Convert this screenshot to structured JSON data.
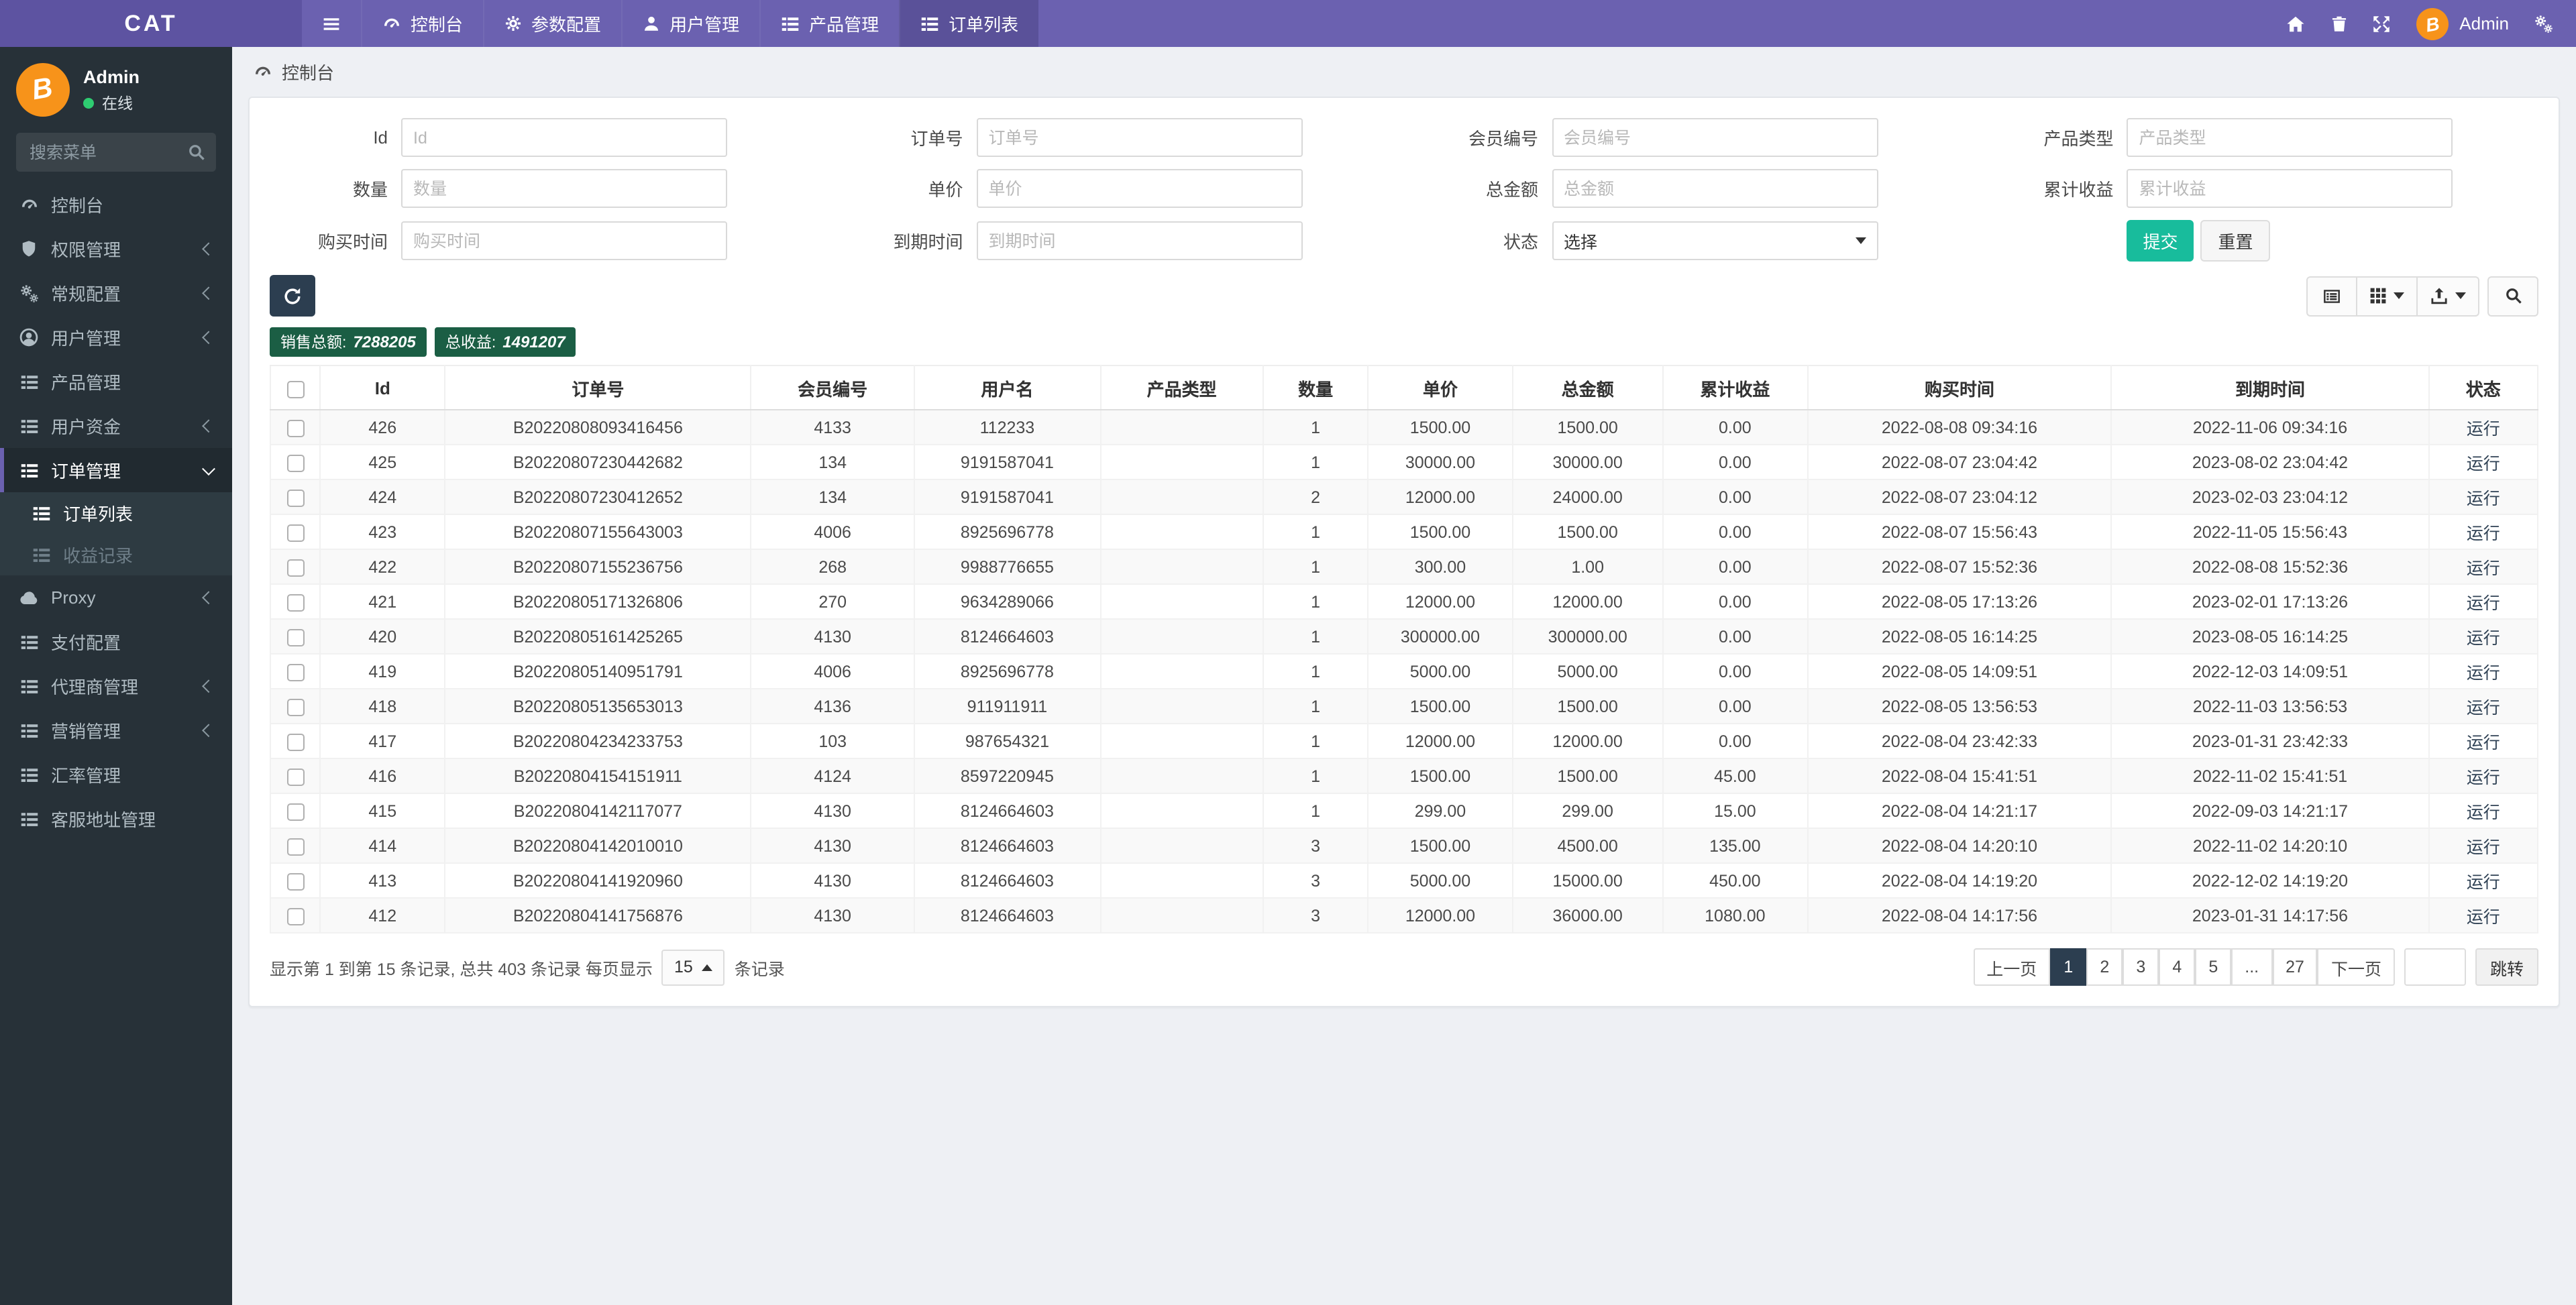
{
  "navbar": {
    "brand": "CAT",
    "items": [
      {
        "label": "控制台",
        "icon": "gauge",
        "name": "dashboard",
        "active": false
      },
      {
        "label": "参数配置",
        "icon": "gear",
        "name": "params-config",
        "active": false
      },
      {
        "label": "用户管理",
        "icon": "user",
        "name": "user-management",
        "active": false
      },
      {
        "label": "产品管理",
        "icon": "list",
        "name": "product-management",
        "active": false
      },
      {
        "label": "订单列表",
        "icon": "list",
        "name": "order-list",
        "active": true
      }
    ],
    "right": {
      "user": {
        "name": "Admin",
        "avatar_glyph": "B"
      }
    }
  },
  "sidebar": {
    "user": {
      "name": "Admin",
      "status": "在线",
      "avatar_glyph": "B"
    },
    "search": {
      "placeholder": "搜索菜单"
    },
    "menu": [
      {
        "label": "控制台",
        "icon": "gauge",
        "name": "dashboard"
      },
      {
        "label": "权限管理",
        "icon": "shield",
        "name": "permission-management",
        "chevron": "left"
      },
      {
        "label": "常规配置",
        "icon": "cogs",
        "name": "general-config",
        "chevron": "left"
      },
      {
        "label": "用户管理",
        "icon": "user-circle",
        "name": "user-management",
        "chevron": "left"
      },
      {
        "label": "产品管理",
        "icon": "list",
        "name": "product-management"
      },
      {
        "label": "用户资金",
        "icon": "list",
        "name": "user-funds",
        "chevron": "left"
      },
      {
        "label": "订单管理",
        "icon": "list",
        "name": "order-management",
        "chevron": "down",
        "active": true,
        "children": [
          {
            "label": "订单列表",
            "icon": "list",
            "name": "order-list",
            "active": true
          },
          {
            "label": "收益记录",
            "icon": "list",
            "name": "profit-records",
            "muted": true
          }
        ]
      },
      {
        "label": "Proxy",
        "icon": "cloud",
        "name": "proxy",
        "chevron": "left"
      },
      {
        "label": "支付配置",
        "icon": "list",
        "name": "payment-config"
      },
      {
        "label": "代理商管理",
        "icon": "list",
        "name": "agent-management",
        "chevron": "left"
      },
      {
        "label": "营销管理",
        "icon": "list",
        "name": "marketing-management",
        "chevron": "left"
      },
      {
        "label": "汇率管理",
        "icon": "list",
        "name": "exchange-rate-management"
      },
      {
        "label": "客服地址管理",
        "icon": "list",
        "name": "service-address-management"
      }
    ]
  },
  "breadcrumb": {
    "label": "控制台"
  },
  "filter_form": {
    "rows": [
      [
        {
          "label": "Id",
          "placeholder": "Id",
          "name": "id",
          "type": "text"
        },
        {
          "label": "订单号",
          "placeholder": "订单号",
          "name": "order-no",
          "type": "text"
        },
        {
          "label": "会员编号",
          "placeholder": "会员编号",
          "name": "member-no",
          "type": "text"
        },
        {
          "label": "产品类型",
          "placeholder": "产品类型",
          "name": "product-type",
          "type": "text"
        }
      ],
      [
        {
          "label": "数量",
          "placeholder": "数量",
          "name": "quantity",
          "type": "text"
        },
        {
          "label": "单价",
          "placeholder": "单价",
          "name": "unit-price",
          "type": "text"
        },
        {
          "label": "总金额",
          "placeholder": "总金额",
          "name": "total-amount",
          "type": "text"
        },
        {
          "label": "累计收益",
          "placeholder": "累计收益",
          "name": "accumulated-profit",
          "type": "text"
        }
      ],
      [
        {
          "label": "购买时间",
          "placeholder": "购买时间",
          "name": "buy-time",
          "type": "text"
        },
        {
          "label": "到期时间",
          "placeholder": "到期时间",
          "name": "expire-time",
          "type": "text"
        },
        {
          "label": "状态",
          "value": "选择",
          "name": "status",
          "type": "select"
        },
        {
          "type": "buttons",
          "name": "form-actions"
        }
      ]
    ],
    "submit_label": "提交",
    "reset_label": "重置"
  },
  "stats": [
    {
      "name": "sales-total",
      "label": "销售总额:",
      "value": "7288205"
    },
    {
      "name": "profit-total",
      "label": "总收益:",
      "value": "1491207"
    }
  ],
  "table": {
    "columns": [
      "Id",
      "订单号",
      "会员编号",
      "用户名",
      "产品类型",
      "数量",
      "单价",
      "总金额",
      "累计收益",
      "购买时间",
      "到期时间",
      "状态"
    ],
    "rows": [
      [
        "426",
        "B20220808093416456",
        "4133",
        "112233",
        "",
        "1",
        "1500.00",
        "1500.00",
        "0.00",
        "2022-08-08 09:34:16",
        "2022-11-06 09:34:16",
        "运行"
      ],
      [
        "425",
        "B20220807230442682",
        "134",
        "9191587041",
        "",
        "1",
        "30000.00",
        "30000.00",
        "0.00",
        "2022-08-07 23:04:42",
        "2023-08-02 23:04:42",
        "运行"
      ],
      [
        "424",
        "B20220807230412652",
        "134",
        "9191587041",
        "",
        "2",
        "12000.00",
        "24000.00",
        "0.00",
        "2022-08-07 23:04:12",
        "2023-02-03 23:04:12",
        "运行"
      ],
      [
        "423",
        "B20220807155643003",
        "4006",
        "8925696778",
        "",
        "1",
        "1500.00",
        "1500.00",
        "0.00",
        "2022-08-07 15:56:43",
        "2022-11-05 15:56:43",
        "运行"
      ],
      [
        "422",
        "B20220807155236756",
        "268",
        "9988776655",
        "",
        "1",
        "300.00",
        "1.00",
        "0.00",
        "2022-08-07 15:52:36",
        "2022-08-08 15:52:36",
        "运行"
      ],
      [
        "421",
        "B20220805171326806",
        "270",
        "9634289066",
        "",
        "1",
        "12000.00",
        "12000.00",
        "0.00",
        "2022-08-05 17:13:26",
        "2023-02-01 17:13:26",
        "运行"
      ],
      [
        "420",
        "B20220805161425265",
        "4130",
        "8124664603",
        "",
        "1",
        "300000.00",
        "300000.00",
        "0.00",
        "2022-08-05 16:14:25",
        "2023-08-05 16:14:25",
        "运行"
      ],
      [
        "419",
        "B20220805140951791",
        "4006",
        "8925696778",
        "",
        "1",
        "5000.00",
        "5000.00",
        "0.00",
        "2022-08-05 14:09:51",
        "2022-12-03 14:09:51",
        "运行"
      ],
      [
        "418",
        "B20220805135653013",
        "4136",
        "911911911",
        "",
        "1",
        "1500.00",
        "1500.00",
        "0.00",
        "2022-08-05 13:56:53",
        "2022-11-03 13:56:53",
        "运行"
      ],
      [
        "417",
        "B20220804234233753",
        "103",
        "987654321",
        "",
        "1",
        "12000.00",
        "12000.00",
        "0.00",
        "2022-08-04 23:42:33",
        "2023-01-31 23:42:33",
        "运行"
      ],
      [
        "416",
        "B20220804154151911",
        "4124",
        "8597220945",
        "",
        "1",
        "1500.00",
        "1500.00",
        "45.00",
        "2022-08-04 15:41:51",
        "2022-11-02 15:41:51",
        "运行"
      ],
      [
        "415",
        "B20220804142117077",
        "4130",
        "8124664603",
        "",
        "1",
        "299.00",
        "299.00",
        "15.00",
        "2022-08-04 14:21:17",
        "2022-09-03 14:21:17",
        "运行"
      ],
      [
        "414",
        "B20220804142010010",
        "4130",
        "8124664603",
        "",
        "3",
        "1500.00",
        "4500.00",
        "135.00",
        "2022-08-04 14:20:10",
        "2022-11-02 14:20:10",
        "运行"
      ],
      [
        "413",
        "B20220804141920960",
        "4130",
        "8124664603",
        "",
        "3",
        "5000.00",
        "15000.00",
        "450.00",
        "2022-08-04 14:19:20",
        "2022-12-02 14:19:20",
        "运行"
      ],
      [
        "412",
        "B20220804141756876",
        "4130",
        "8124664603",
        "",
        "3",
        "12000.00",
        "36000.00",
        "1080.00",
        "2022-08-04 14:17:56",
        "2023-01-31 14:17:56",
        "运行"
      ]
    ]
  },
  "pagination": {
    "summary_prefix": "显示第 1 到第 15 条记录, 总共 403 条记录 每页显示",
    "page_size": "15",
    "summary_suffix": "条记录",
    "pages": [
      "上一页",
      "1",
      "2",
      "3",
      "4",
      "5",
      "...",
      "27",
      "下一页"
    ],
    "active_page": "1",
    "jump_label": "跳转"
  }
}
